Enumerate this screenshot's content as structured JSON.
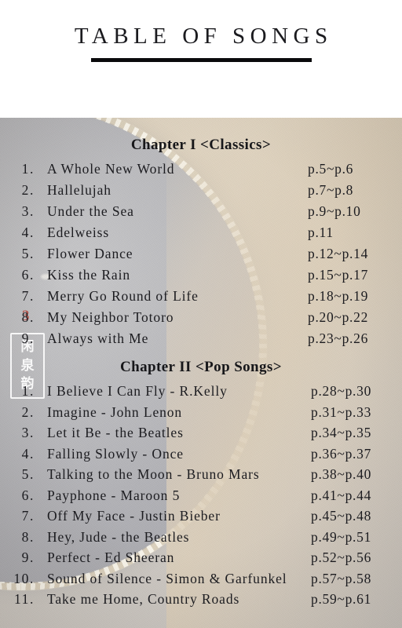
{
  "document": {
    "title": "TABLE OF SONGS"
  },
  "watermark": {
    "characters": [
      "闲",
      "泉",
      "韵"
    ],
    "stamp": "3"
  },
  "colors": {
    "page_background": "#ffffff",
    "title_text": "#1b1b1f",
    "title_rule": "#0a0a0c",
    "body_text": "#1c1c20",
    "photo_beige": "#ded2c0",
    "photo_gray": "#b4b4b8",
    "rim_cream": "#efe6d4",
    "stamp_red": "#b03a2e"
  },
  "chapters": [
    {
      "heading": "Chapter I <Classics>",
      "entries": [
        {
          "number": "1.",
          "title": "A Whole New World",
          "pages": "p.5~p.6"
        },
        {
          "number": "2.",
          "title": "Hallelujah",
          "pages": "p.7~p.8"
        },
        {
          "number": "3.",
          "title": "Under the Sea",
          "pages": "p.9~p.10"
        },
        {
          "number": "4.",
          "title": "Edelweiss",
          "pages": "p.11"
        },
        {
          "number": "5.",
          "title": "Flower Dance",
          "pages": "p.12~p.14"
        },
        {
          "number": "6.",
          "title": "Kiss the Rain",
          "pages": "p.15~p.17"
        },
        {
          "number": "7.",
          "title": "Merry Go Round of Life",
          "pages": "p.18~p.19"
        },
        {
          "number": "8.",
          "title": "My Neighbor Totoro",
          "pages": "p.20~p.22"
        },
        {
          "number": "9.",
          "title": "Always with Me",
          "pages": "p.23~p.26"
        }
      ]
    },
    {
      "heading": "Chapter II <Pop Songs>",
      "entries": [
        {
          "number": "1.",
          "title": "I Believe I Can Fly - R.Kelly",
          "pages": "p.28~p.30"
        },
        {
          "number": "2.",
          "title": "Imagine - John Lenon",
          "pages": "p.31~p.33"
        },
        {
          "number": "3.",
          "title": "Let it Be - the Beatles",
          "pages": "p.34~p.35"
        },
        {
          "number": "4.",
          "title": "Falling Slowly - Once",
          "pages": "p.36~p.37"
        },
        {
          "number": "5.",
          "title": "Talking to the Moon - Bruno Mars",
          "pages": "p.38~p.40"
        },
        {
          "number": "6.",
          "title": "Payphone - Maroon 5",
          "pages": "p.41~p.44"
        },
        {
          "number": "7.",
          "title": "Off My Face - Justin Bieber",
          "pages": "p.45~p.48"
        },
        {
          "number": "8.",
          "title": "Hey, Jude - the Beatles",
          "pages": "p.49~p.51"
        },
        {
          "number": "9.",
          "title": "Perfect - Ed Sheeran",
          "pages": "p.52~p.56"
        },
        {
          "number": "10.",
          "title": "Sound of Silence - Simon & Garfunkel",
          "pages": "p.57~p.58"
        },
        {
          "number": "11.",
          "title": "Take me Home, Country Roads",
          "pages": "p.59~p.61"
        }
      ]
    }
  ]
}
